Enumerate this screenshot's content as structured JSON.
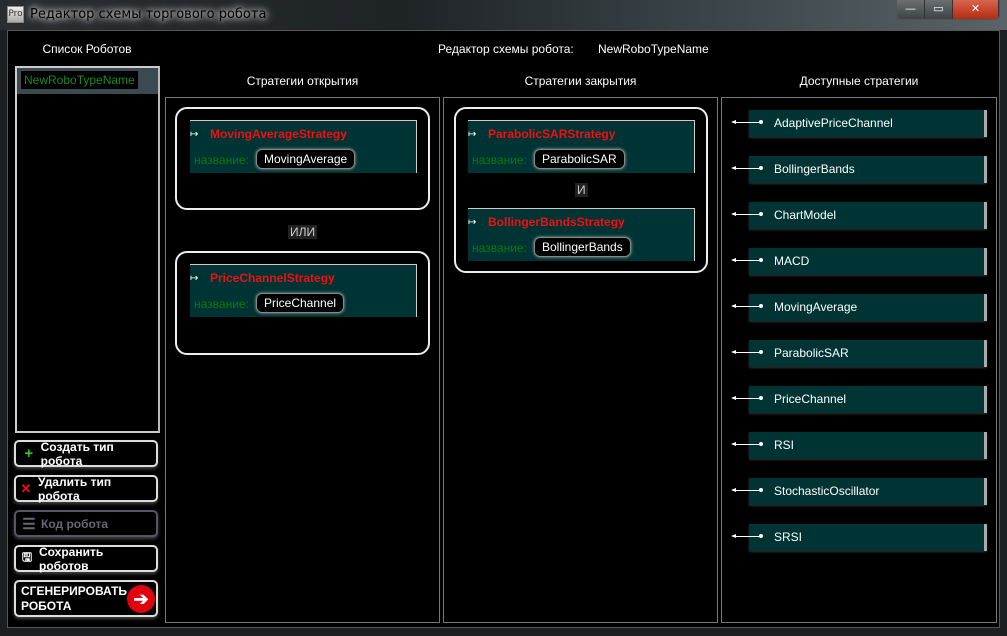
{
  "window": {
    "icon": "Pro",
    "title": "Редактор схемы торгового робота",
    "minimize": "—",
    "maximize": "▭",
    "close": "✕"
  },
  "sidebar": {
    "title": "Список Роботов",
    "robots": [
      "NewRoboTypeName"
    ],
    "buttons": [
      {
        "label": "Создать тип робота",
        "icon": "+"
      },
      {
        "label": "Удалить тип робота",
        "icon": "✕"
      },
      {
        "label": "Код робота",
        "icon": "☰",
        "disabled": true
      },
      {
        "label": "Сохранить роботов",
        "icon": "🖫"
      },
      {
        "label": "СГЕНЕРИРОВАТЬ РОБОТА",
        "icon": "➔"
      }
    ]
  },
  "editor": {
    "label": "Редактор схемы робота:",
    "robot_name": "NewRoboTypeName"
  },
  "open": {
    "title": "Стратегии открытия",
    "conjunction": "ИЛИ",
    "caption": "название:",
    "groups": [
      [
        {
          "strategy": "MovingAverageStrategy",
          "name": "MovingAverage"
        }
      ],
      [
        {
          "strategy": "PriceChannelStrategy",
          "name": "PriceChannel"
        }
      ]
    ]
  },
  "close": {
    "title": "Стратегии закрытия",
    "conjunction": "И",
    "caption": "название:",
    "groups": [
      [
        {
          "strategy": "ParabolicSARStrategy",
          "name": "ParabolicSAR"
        },
        {
          "strategy": "BollingerBandsStrategy",
          "name": "BollingerBands"
        }
      ]
    ]
  },
  "available": {
    "title": "Доступные стратегии",
    "items": [
      "AdaptivePriceChannel",
      "BollingerBands",
      "ChartModel",
      "MACD",
      "MovingAverage",
      "ParabolicSAR",
      "PriceChannel",
      "RSI",
      "StochasticOscillator",
      "SRSI"
    ]
  },
  "colors": {
    "card_bg": "#003333",
    "strategy_name": "#f01010",
    "caption": "#0a7a0a"
  }
}
